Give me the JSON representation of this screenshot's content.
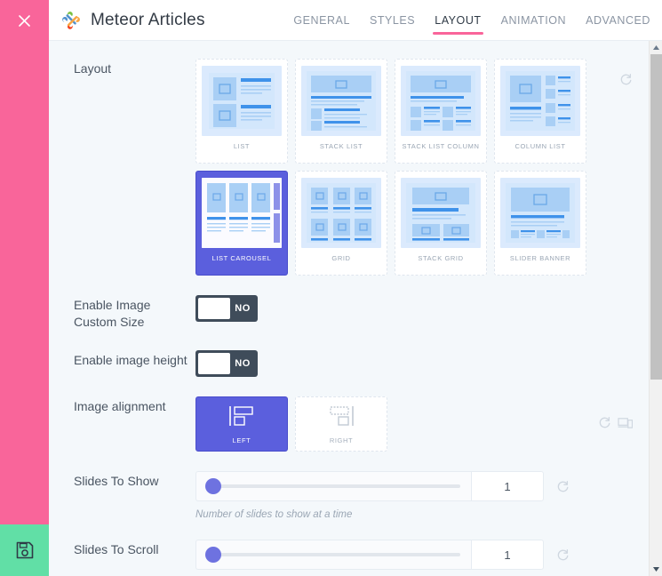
{
  "rail": {
    "close_icon": "close-icon",
    "save_icon": "save-floppy-icon"
  },
  "header": {
    "logo_icon": "joomla-logo-icon",
    "title": "Meteor Articles",
    "tabs": [
      {
        "label": "GENERAL",
        "active": false
      },
      {
        "label": "STYLES",
        "active": false
      },
      {
        "label": "LAYOUT",
        "active": true
      },
      {
        "label": "ANIMATION",
        "active": false
      },
      {
        "label": "ADVANCED",
        "active": false
      }
    ]
  },
  "settings": {
    "layout": {
      "label": "Layout",
      "reset_icon": "reset-icon",
      "options": [
        {
          "name": "LIST",
          "selected": false
        },
        {
          "name": "STACK LIST",
          "selected": false
        },
        {
          "name": "STACK LIST COLUMN",
          "selected": false
        },
        {
          "name": "COLUMN LIST",
          "selected": false
        },
        {
          "name": "LIST CAROUSEL",
          "selected": true
        },
        {
          "name": "GRID",
          "selected": false
        },
        {
          "name": "STACK GRID",
          "selected": false
        },
        {
          "name": "SLIDER BANNER",
          "selected": false
        }
      ]
    },
    "enable_image_custom_size": {
      "label": "Enable Image Custom Size",
      "value": "NO",
      "state": false
    },
    "enable_image_height": {
      "label": "Enable image height",
      "value": "NO",
      "state": false
    },
    "image_alignment": {
      "label": "Image alignment",
      "reset_icon": "reset-icon",
      "device_icon": "responsive-device-icon",
      "options": [
        {
          "name": "LEFT",
          "selected": true
        },
        {
          "name": "RIGHT",
          "selected": false
        }
      ]
    },
    "slides_to_show": {
      "label": "Slides To Show",
      "value": "1",
      "help": "Number of slides to show at a time",
      "reset_icon": "reset-icon",
      "percent": 0
    },
    "slides_to_scroll": {
      "label": "Slides To Scroll",
      "value": "1",
      "reset_icon": "reset-icon",
      "percent": 0
    }
  },
  "scrollbar": {
    "up_icon": "scroll-up-arrow-icon",
    "down_icon": "scroll-down-arrow-icon",
    "thumb": "scrollbar-thumb"
  },
  "colors": {
    "accent_pink": "#f9659a",
    "accent_purple": "#5b5fdd",
    "save_green": "#61dfa6",
    "toggle_dark": "#3f4c5a",
    "page_bg": "#f4f8fb",
    "thumb_blue": "#dbeafd"
  }
}
